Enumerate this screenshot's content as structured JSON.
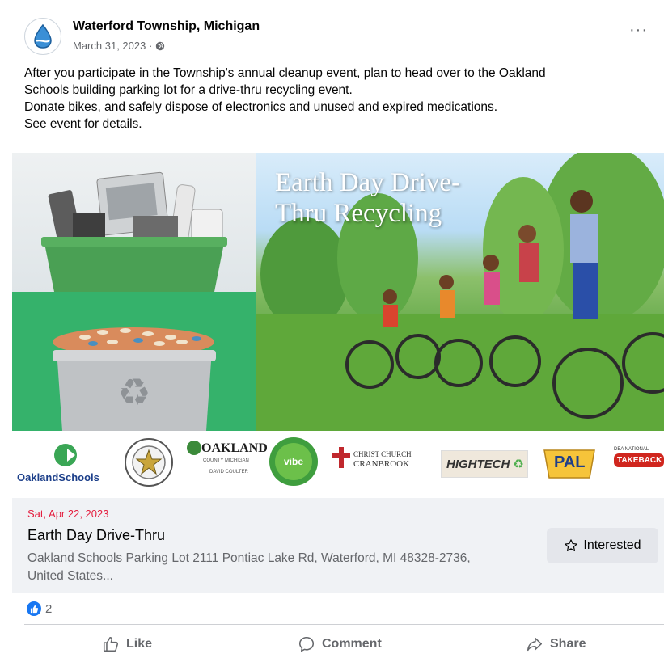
{
  "post": {
    "page_name": "Waterford Township, Michigan",
    "date": "March 31, 2023 ·",
    "privacy_icon": "globe-icon",
    "more_label": "···",
    "text_lines": [
      "After you participate in the Township's annual cleanup event, plan to head over to the Oakland",
      "Schools building parking lot for a drive-thru recycling event.",
      "Donate bikes, and safely dispose of electronics and unused and expired medications.",
      "See event for details."
    ]
  },
  "media": {
    "title_line1": "Earth Day Drive-",
    "title_line2": "Thru Recycling",
    "logos": {
      "oakland_schools": "OaklandSchools",
      "oakland_county_top": "OAKLAND",
      "oakland_county_sub": "COUNTY MICHIGAN",
      "oakland_county_name": "DAVID COULTER",
      "vibe": "vibe",
      "christ_church_1": "CHRIST CHURCH",
      "christ_church_2": "CRANBROOK",
      "hightech": "HIGHTECH",
      "pal": "PAL",
      "dea_top": "DEA NATIONAL",
      "dea_main": "TAKEBACK"
    }
  },
  "event": {
    "date": "Sat, Apr 22, 2023",
    "title": "Earth Day Drive-Thru",
    "location_line1": "Oakland Schools Parking Lot 2111 Pontiac Lake Rd, Waterford, MI 48328-2736,",
    "location_line2": "United States...",
    "interested_label": "Interested"
  },
  "reactions": {
    "count": "2"
  },
  "actions": {
    "like": "Like",
    "comment": "Comment",
    "share": "Share"
  },
  "colors": {
    "accent": "#1877f2",
    "event_date": "#e41e3f",
    "secondary_text": "#65676b"
  }
}
